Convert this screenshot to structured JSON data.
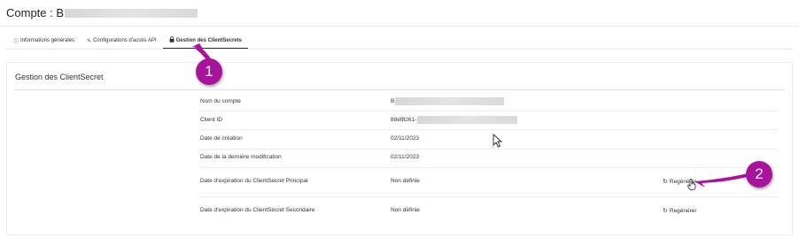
{
  "header": {
    "title": "Compte : B"
  },
  "tabs": [
    {
      "icon": "info-icon",
      "label": "Informations générales"
    },
    {
      "icon": "pencil-icon",
      "label": "Configurations d'accès API"
    },
    {
      "icon": "lock-icon",
      "label": "Gestion des ClientSecrets",
      "active": true
    }
  ],
  "panel": {
    "title": "Gestion des ClientSecret",
    "rows": [
      {
        "label": "Nom du compte",
        "value": "B"
      },
      {
        "label": "Client ID",
        "value": "88ef8261-"
      },
      {
        "label": "Date de création",
        "value": "02/11/2023"
      },
      {
        "label": "Date de la dernière modification",
        "value": "02/11/2023"
      },
      {
        "label": "Date d'expiration du ClientSecret Principal",
        "value": "Non définie",
        "action": "Regénérer"
      },
      {
        "label": "Date d'expiration du ClientSecret Secondaire",
        "value": "Non définie",
        "action": "Regénérer"
      }
    ]
  },
  "annotations": {
    "badge1": "1",
    "badge2": "2",
    "color": "#a8139b"
  },
  "icons": {
    "regenerate": "refresh-icon"
  }
}
